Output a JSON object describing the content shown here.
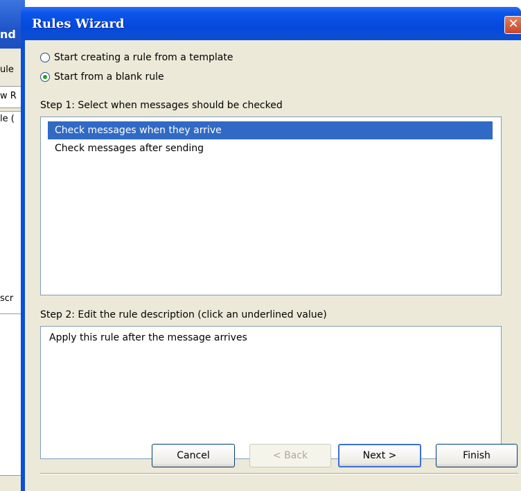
{
  "background_window": {
    "title_fragment": "nd",
    "fragments": [
      "ule",
      "w R",
      "le (",
      "scr"
    ]
  },
  "dialog": {
    "title": "Rules Wizard",
    "close_glyph": "✕",
    "radio_template_label": "Start creating a rule from a template",
    "radio_blank_label": "Start from a blank rule",
    "selected_option": "blank",
    "step1_label": "Step 1: Select when messages should be checked",
    "step1_items": [
      {
        "label": "Check messages when they arrive",
        "selected": true
      },
      {
        "label": "Check messages after sending",
        "selected": false
      }
    ],
    "step2_label": "Step 2: Edit the rule description (click an underlined value)",
    "step2_text": "Apply this rule after the message arrives"
  },
  "buttons": {
    "cancel": "Cancel",
    "back": "< Back",
    "next": "Next >",
    "finish": "Finish"
  },
  "colors": {
    "title_bar": "#0a55e8",
    "selection": "#316ac5",
    "dialog_face": "#ece9d8"
  }
}
